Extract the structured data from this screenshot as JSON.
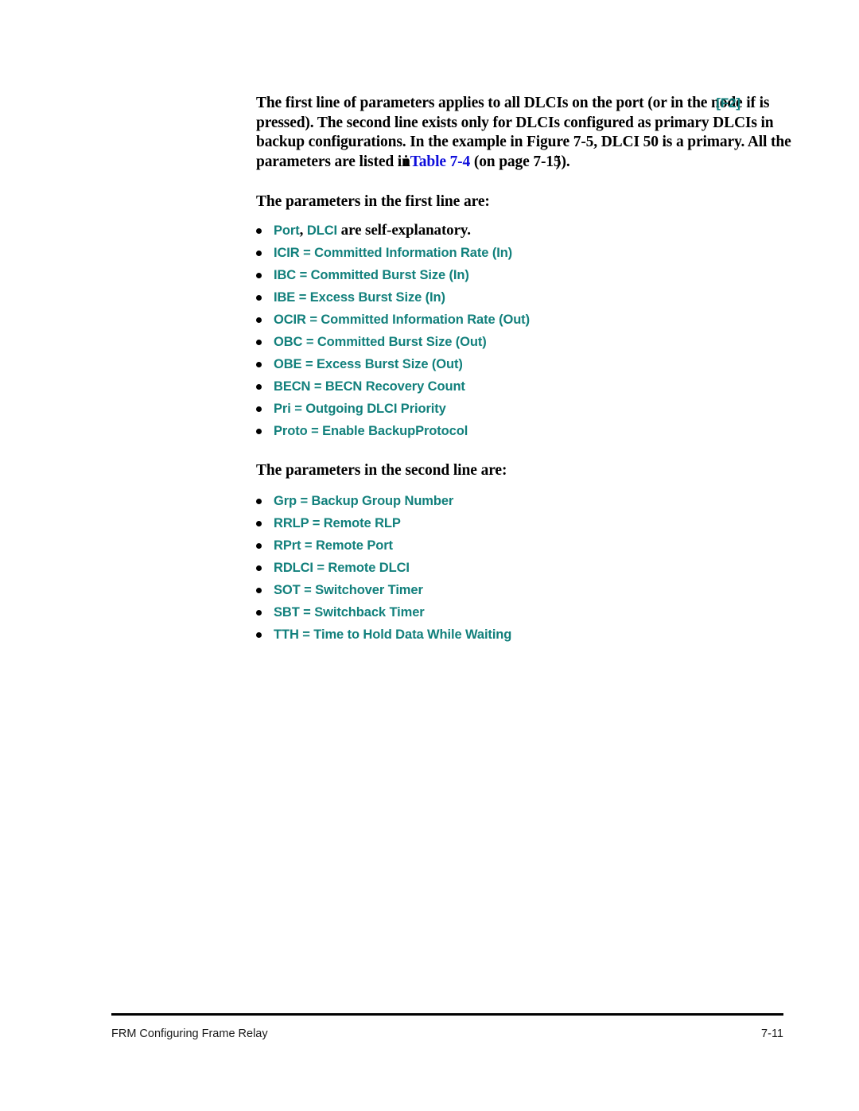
{
  "document": {
    "page_number_label": "7-11",
    "footer_title": "FRM Configuring Frame Relay"
  },
  "colors": {
    "body_text": "#000000",
    "parameter_teal": "#12807c",
    "cross_reference_blue": "#0d0ddb",
    "page_background": "#ffffff"
  },
  "intro": {
    "part1": "The first line of parameters applies to all DLCIs on the port (or in the no",
    "overlap_under": "de if",
    "overlap_over": "[F2]",
    "part2": " is pressed). The second line exists only for DLCIs configured as primary DLCIs in backup configurations. In the example in Figure 7-5, DLCI 50 is a primary. All the parameters are listed in",
    "link_ghost": "i",
    "link_label": "Table 7-4",
    "part3": " (on page 7-15",
    "tail_ghost": ")",
    "tail": ")."
  },
  "section_first": {
    "heading": "The parameters in the first line are:",
    "bullets": [
      {
        "mixed": true,
        "teal1": "Port",
        "sep": ", ",
        "teal2": "DLCI",
        "rest": " are self-explanatory."
      },
      {
        "text": "ICIR = Committed Information Rate (In)"
      },
      {
        "text": "IBC = Committed Burst Size (In)"
      },
      {
        "text": "IBE =  Excess Burst Size (In)"
      },
      {
        "text": "OCIR = Committed Information Rate (Out)"
      },
      {
        "text": "OBC =  Committed Burst Size (Out)"
      },
      {
        "text": "OBE =  Excess Burst Size (Out)"
      },
      {
        "text": "BECN = BECN Recovery Count"
      },
      {
        "text": "Pri = Outgoing DLCI Priority"
      },
      {
        "text": "Proto = Enable BackupProtocol"
      }
    ]
  },
  "section_second": {
    "heading": "The parameters in the second line are:",
    "bullets": [
      {
        "text": "Grp =  Backup Group Number"
      },
      {
        "text": "RRLP = Remote RLP"
      },
      {
        "text": "RPrt =  Remote Port"
      },
      {
        "text": "RDLCI = Remote DLCI"
      },
      {
        "text": "SOT = Switchover Timer"
      },
      {
        "text": "SBT = Switchback Timer"
      },
      {
        "text": "TTH = Time to Hold Data While Waiting"
      }
    ]
  }
}
